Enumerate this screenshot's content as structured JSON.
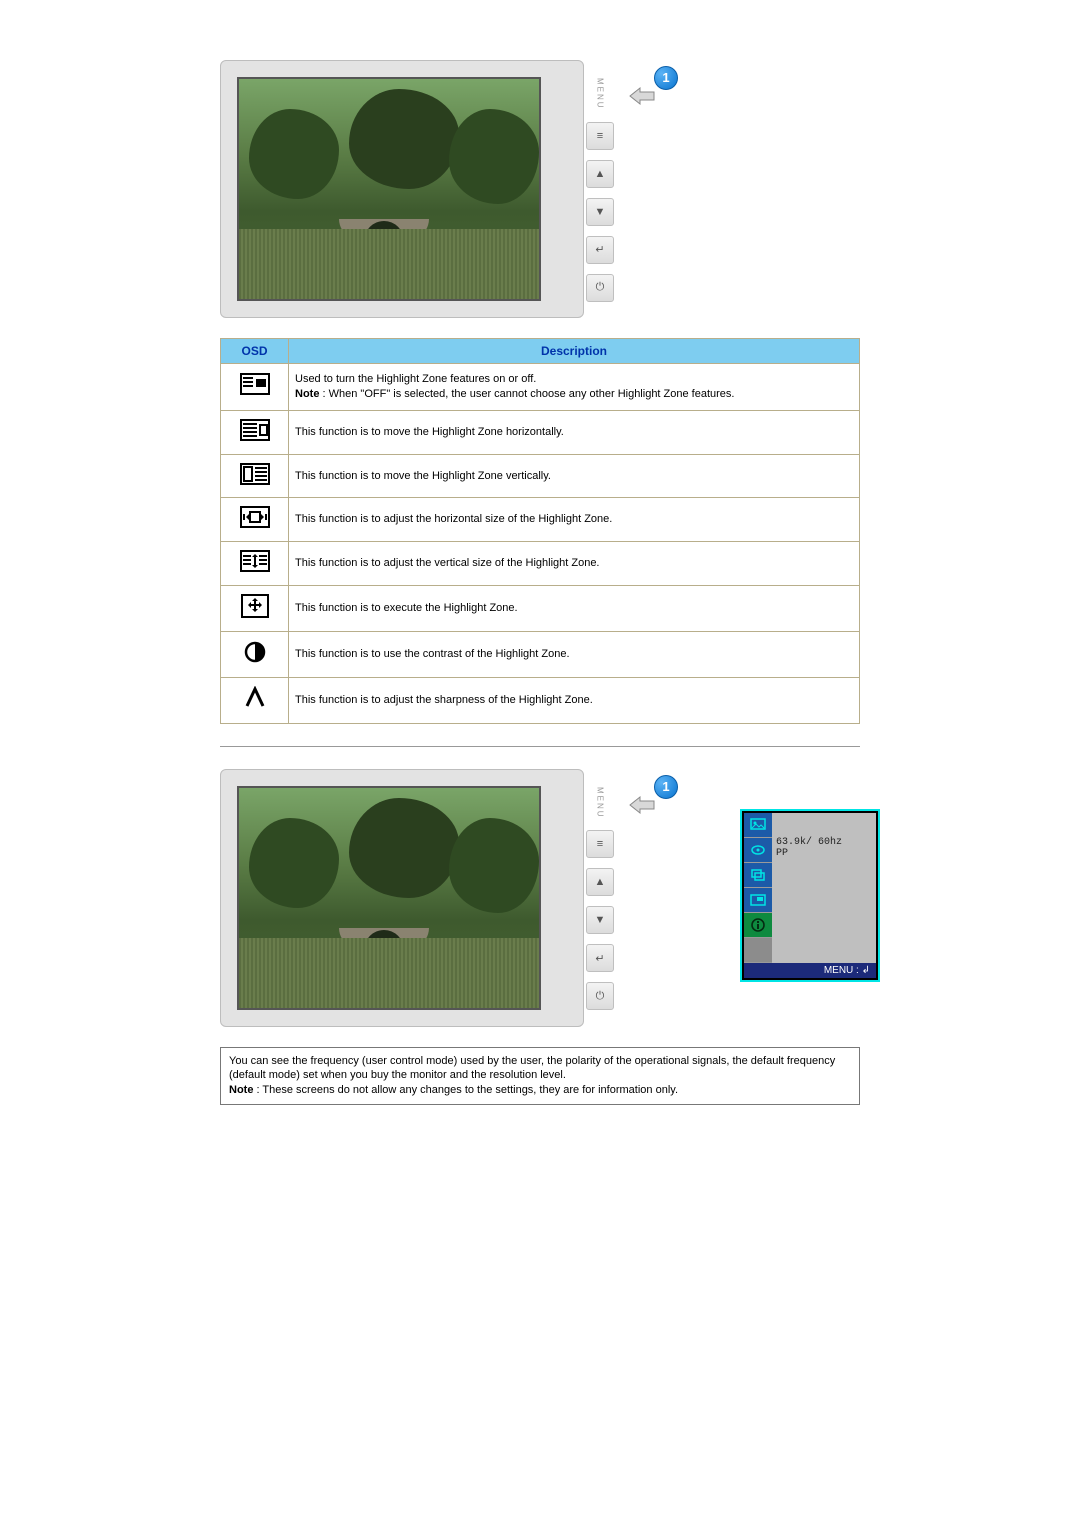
{
  "callout_number": "1",
  "monitor_buttons": {
    "menu_label": "MENU",
    "up": "▲",
    "down": "▼",
    "enter": "↵",
    "power": "⏻"
  },
  "table": {
    "headers": {
      "osd": "OSD",
      "description": "Description"
    },
    "rows": [
      {
        "icon_name": "highlight-zone-toggle-icon",
        "desc_html": "Used to turn the Highlight Zone features on or off.<br><b>Note</b> : When \"OFF\" is selected, the user cannot choose any other Highlight Zone features."
      },
      {
        "icon_name": "highlight-zone-horizontal-move-icon",
        "desc_html": "This function is to move the Highlight Zone horizontally."
      },
      {
        "icon_name": "highlight-zone-vertical-move-icon",
        "desc_html": "This function is to move the Highlight Zone vertically."
      },
      {
        "icon_name": "highlight-zone-horizontal-size-icon",
        "desc_html": "This function is to adjust the horizontal size of the Highlight Zone."
      },
      {
        "icon_name": "highlight-zone-vertical-size-icon",
        "desc_html": "This function is to adjust the vertical size of the Highlight Zone."
      },
      {
        "icon_name": "highlight-zone-execute-icon",
        "desc_html": "This function is to execute the Highlight Zone."
      },
      {
        "icon_name": "highlight-zone-contrast-icon",
        "desc_html": "This function is to use the contrast of the Highlight Zone."
      },
      {
        "icon_name": "highlight-zone-sharpness-icon",
        "desc_html": "This function is to adjust the sharpness of the Highlight Zone."
      }
    ]
  },
  "osd_overlay": {
    "freq_line1": "63.9k/ 60hz",
    "freq_line2": "PP",
    "footer": "MENU : ↲"
  },
  "info_box": {
    "line1": "You can see the frequency (user control mode) used by the user, the polarity of the operational signals, the default frequency (default mode) set when you buy the monitor and the resolution level.",
    "note_label": "Note",
    "note_rest": " : These screens do not allow any changes to the settings, they are for information only."
  }
}
